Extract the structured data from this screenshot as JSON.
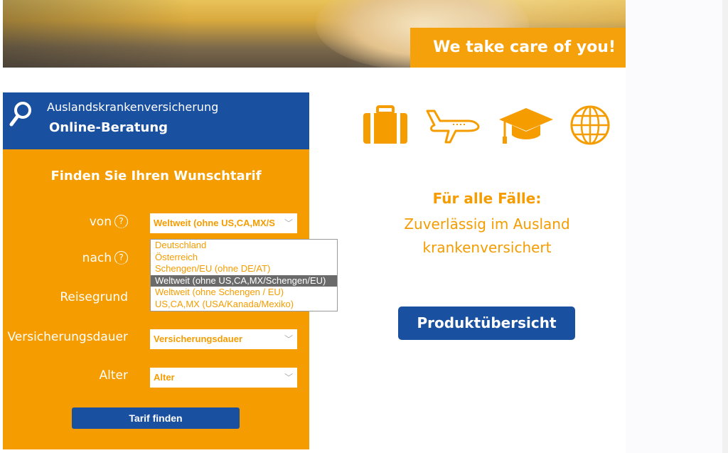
{
  "hero": {
    "tagline": "We take care of you!"
  },
  "widget": {
    "subtitle": "Auslandskrankenversicherung",
    "title": "Online-Beratung",
    "find_title": "Finden Sie Ihren Wunschtarif",
    "help_glyph": "?",
    "fields": {
      "von": {
        "label": "von",
        "value": "Weltweit (ohne US,CA,MX/S"
      },
      "nach": {
        "label": "nach"
      },
      "reisegrund": {
        "label": "Reisegrund"
      },
      "dauer": {
        "label": "Versicherungsdauer",
        "value": "Versicherungsdauer"
      },
      "alter": {
        "label": "Alter",
        "value": "Alter"
      }
    },
    "dropdown_options": [
      "Deutschland",
      "Österreich",
      "Schengen/EU (ohne DE/AT)",
      "Weltweit (ohne US,CA,MX/Schengen/EU)",
      "Weltweit (ohne Schengen / EU)",
      "US,CA,MX (USA/Kanada/Mexiko)"
    ],
    "dropdown_selected_index": 3,
    "submit_label": "Tarif finden"
  },
  "right": {
    "icons": [
      "suitcase-icon",
      "airplane-icon",
      "graduation-cap-icon",
      "globe-icon"
    ],
    "tagline_bold": "Für alle Fälle:",
    "tagline_line2": "Zuverlässig im Ausland",
    "tagline_line3": "krankenversichert",
    "product_button": "Produktübersicht"
  },
  "colors": {
    "orange": "#f59c00",
    "blue": "#1a50a0"
  }
}
